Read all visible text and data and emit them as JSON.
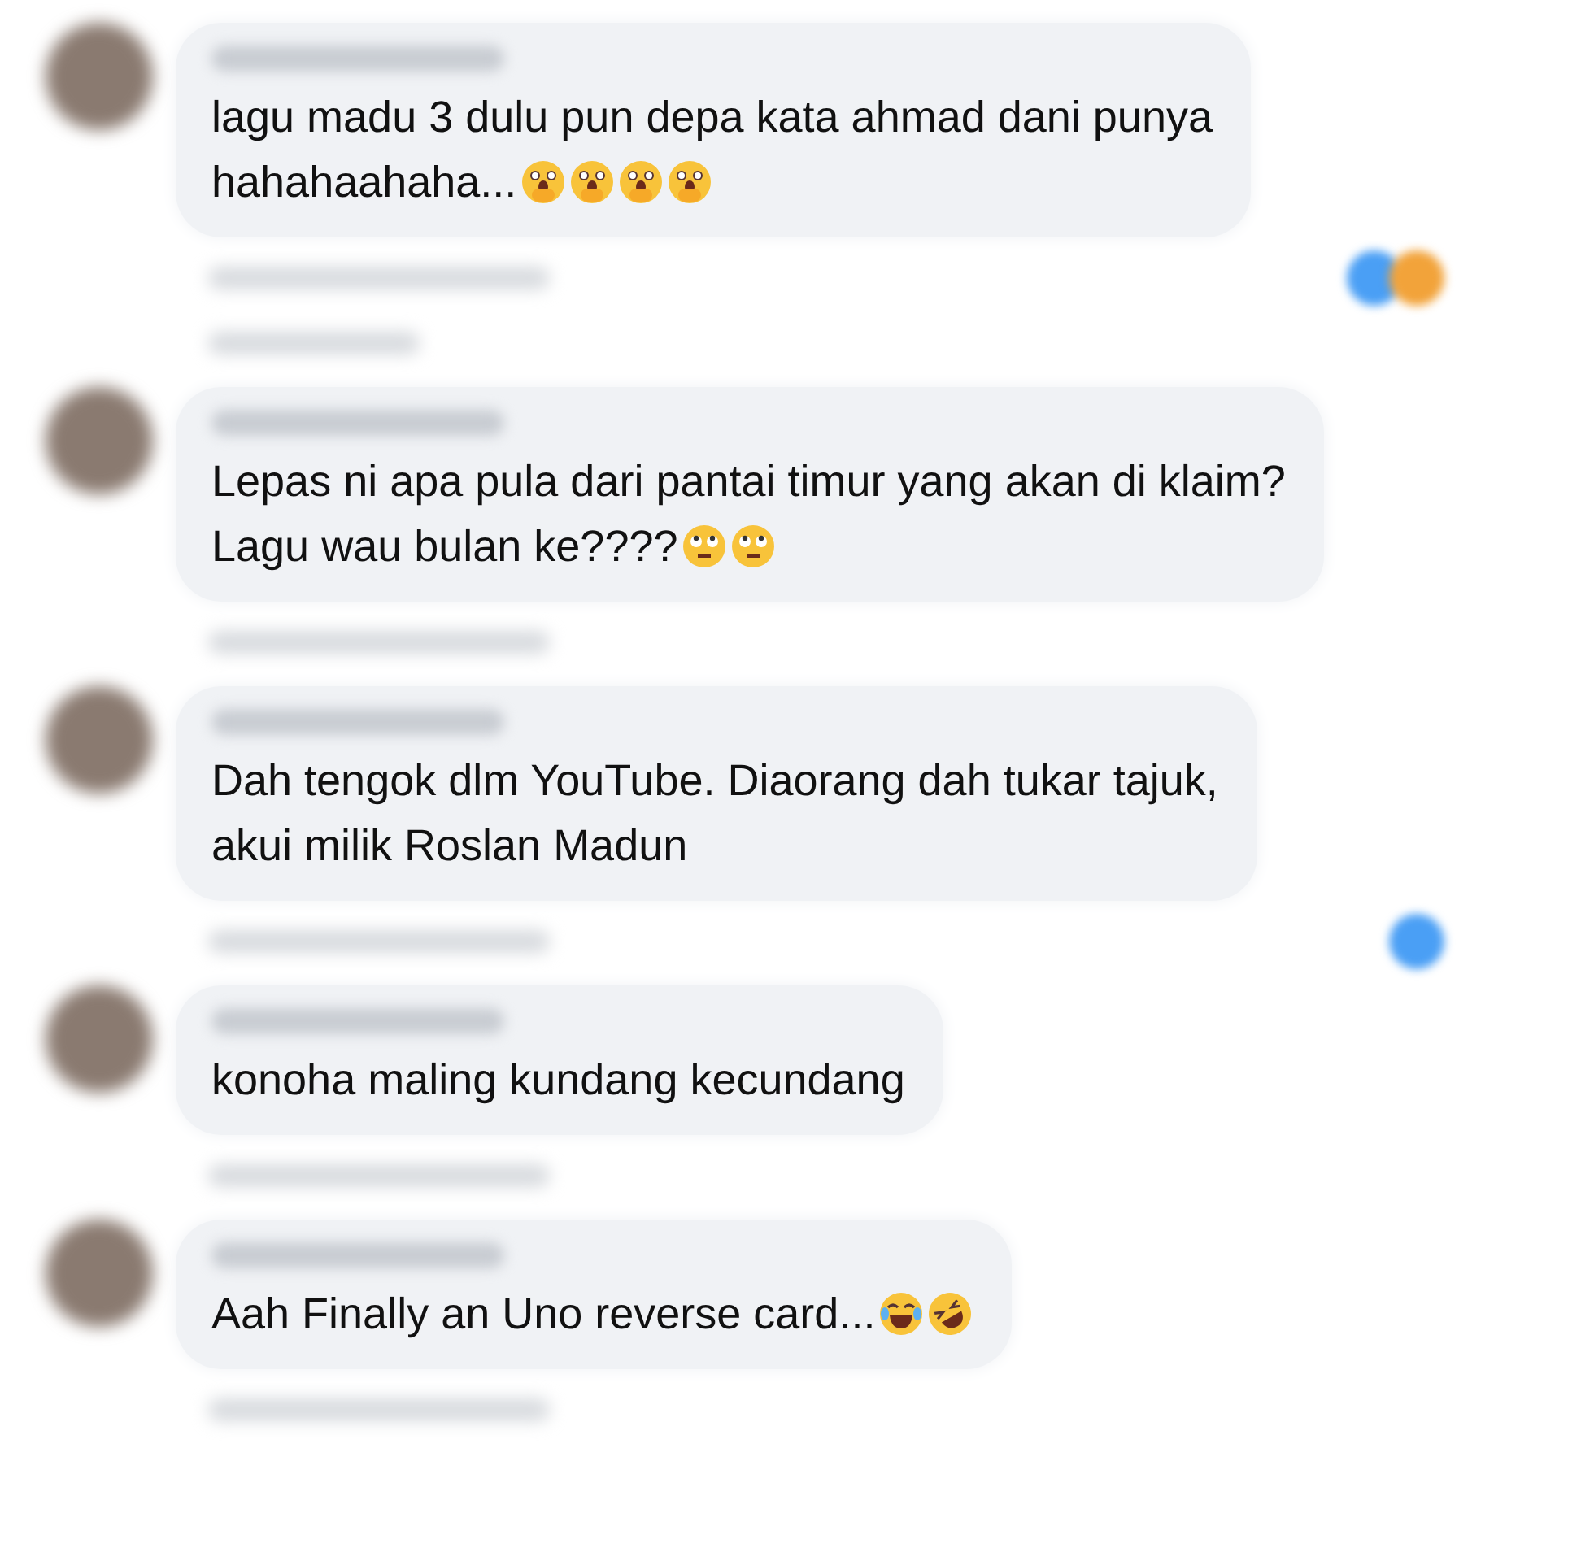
{
  "comments": [
    {
      "lines": [
        "lagu madu 3 dulu pun depa kata ahmad dani punya",
        "hahahaahaha..."
      ],
      "emojis": [
        {
          "kind": "hand-over-mouth"
        },
        {
          "kind": "hand-over-mouth"
        },
        {
          "kind": "hand-over-mouth"
        },
        {
          "kind": "hand-over-mouth"
        }
      ],
      "reactions": [
        {
          "color": "#4a9ff5"
        },
        {
          "color": "#f2a33a"
        }
      ],
      "replies_shown": true
    },
    {
      "lines": [
        "Lepas ni apa pula dari pantai timur yang akan di klaim?",
        "Lagu wau bulan ke????"
      ],
      "emojis": [
        {
          "kind": "eye-roll"
        },
        {
          "kind": "eye-roll"
        }
      ],
      "replies_shown": false
    },
    {
      "lines": [
        "Dah tengok dlm YouTube. Diaorang dah tukar tajuk,",
        "akui milik Roslan Madun"
      ],
      "reactions": [
        {
          "color": "#4a9ff5"
        }
      ],
      "replies_shown": false
    },
    {
      "lines": [
        "konoha maling kundang kecundang"
      ],
      "replies_shown": false
    },
    {
      "lines": [
        "Aah Finally an Uno reverse card..."
      ],
      "emojis": [
        {
          "kind": "tears-of-joy"
        },
        {
          "kind": "rolling-laughing"
        }
      ],
      "replies_shown": false
    }
  ]
}
